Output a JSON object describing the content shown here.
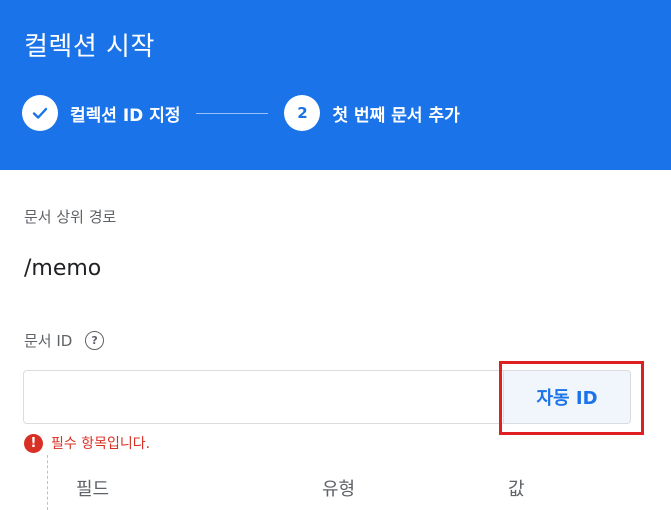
{
  "header": {
    "title": "컬렉션 시작",
    "steps": [
      {
        "marker": "✓",
        "label": "컬렉션 ID 지정",
        "status": "completed"
      },
      {
        "marker": "2",
        "label": "첫 번째 문서 추가",
        "status": "active"
      }
    ]
  },
  "form": {
    "parent_path_label": "문서 상위 경로",
    "parent_path_value": "/memo",
    "document_id_label": "문서 ID",
    "help_icon_glyph": "?",
    "document_id_value": "",
    "auto_id_button": "자동 ID",
    "error_icon_glyph": "!",
    "error_message": "필수 항목입니다.",
    "columns": [
      "필드",
      "유형",
      "값"
    ]
  },
  "colors": {
    "header_bg": "#1a73e8",
    "button_text": "#1a73e8",
    "error": "#d93025",
    "highlight": "#e02020"
  }
}
